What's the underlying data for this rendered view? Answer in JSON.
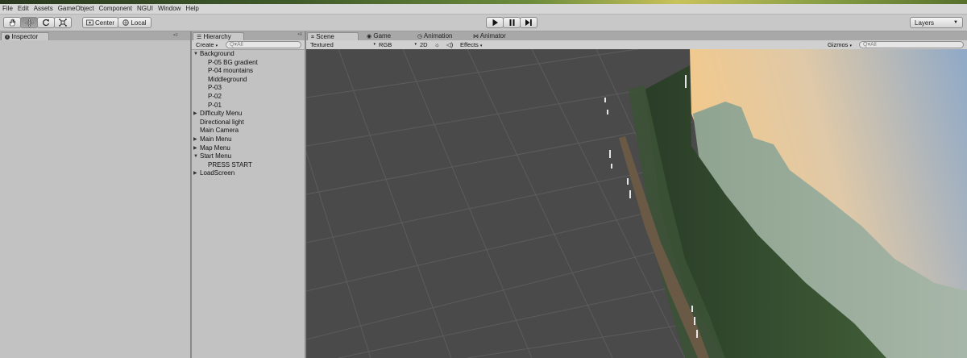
{
  "menubar": {
    "items": [
      "File",
      "Edit",
      "Assets",
      "GameObject",
      "Component",
      "NGUI",
      "Window",
      "Help"
    ]
  },
  "toolbar": {
    "tools": [
      {
        "name": "hand-tool",
        "icon": "hand-icon"
      },
      {
        "name": "move-tool",
        "icon": "move-icon",
        "active": true
      },
      {
        "name": "rotate-tool",
        "icon": "rotate-icon"
      },
      {
        "name": "scale-tool",
        "icon": "scale-icon"
      }
    ],
    "pivot_mode": "Center",
    "pivot_space": "Local",
    "play_icon": "play-icon",
    "pause_icon": "pause-icon",
    "step_icon": "step-icon",
    "layers_label": "Layers"
  },
  "inspector": {
    "tab_label": "Inspector",
    "tab_icon": "info-icon"
  },
  "hierarchy": {
    "tab_label": "Hierarchy",
    "create_label": "Create",
    "search_placeholder": "Q▾All",
    "items": [
      {
        "label": "Background",
        "depth": 0,
        "expander": "expanded"
      },
      {
        "label": "P-05 BG gradient",
        "depth": 1,
        "expander": "none"
      },
      {
        "label": "P-04 mountains",
        "depth": 1,
        "expander": "none"
      },
      {
        "label": "Middleground",
        "depth": 1,
        "expander": "none"
      },
      {
        "label": "P-03",
        "depth": 1,
        "expander": "none"
      },
      {
        "label": "P-02",
        "depth": 1,
        "expander": "none"
      },
      {
        "label": "P-01",
        "depth": 1,
        "expander": "none"
      },
      {
        "label": "Difficulty Menu",
        "depth": 0,
        "expander": "collapsed"
      },
      {
        "label": "Directional light",
        "depth": 0,
        "expander": "none"
      },
      {
        "label": "Main Camera",
        "depth": 0,
        "expander": "none"
      },
      {
        "label": "Main Menu",
        "depth": 0,
        "expander": "collapsed"
      },
      {
        "label": "Map Menu",
        "depth": 0,
        "expander": "collapsed"
      },
      {
        "label": "Start Menu",
        "depth": 0,
        "expander": "expanded"
      },
      {
        "label": "PRESS START",
        "depth": 1,
        "expander": "none"
      },
      {
        "label": "LoadScreen",
        "depth": 0,
        "expander": "collapsed"
      }
    ]
  },
  "scene_tabs": {
    "scene": "Scene",
    "game": "Game",
    "animation": "Animation",
    "animator": "Animator"
  },
  "scene_toolbar": {
    "shading": "Textured",
    "render_mode": "RGB",
    "mode_2d": "2D",
    "effects": "Effects",
    "gizmos": "Gizmos",
    "search_placeholder": "Q▾All"
  },
  "colors": {
    "scene_bg": "#4a4a4a",
    "sky_top": "#8fa9c8",
    "sky_bottom": "#f3c98a",
    "mountain": "#a8b8a0",
    "forest": "#2f4a2a"
  }
}
